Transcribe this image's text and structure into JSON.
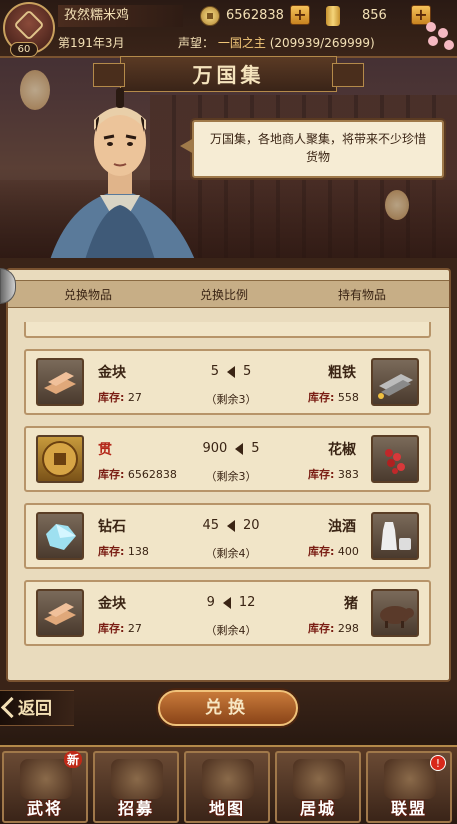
{
  "header": {
    "player_name": "孜然糯米鸡",
    "level": "60",
    "coins": "6562838",
    "gold": "856",
    "date": "第191年3月",
    "fame_label": "声望：",
    "fame_title": "一国之主",
    "fame_progress": "(209939/269999)"
  },
  "page": {
    "title": "万国集",
    "npc_dialog": "万国集，各地商人聚集，将带来不少珍惜货物"
  },
  "table": {
    "col_item": "兑换物品",
    "col_ratio": "兑换比例",
    "col_owned": "持有物品",
    "stock_label": "库存:",
    "rows": [
      {
        "give_name": "金块",
        "give_stock": "27",
        "give_icon": "gold-bar-icon",
        "ratio_give": "5",
        "ratio_get": "5",
        "remain": "（剩余3）",
        "get_name": "粗铁",
        "get_stock": "558",
        "get_icon": "iron-ingot-icon",
        "give_red": false
      },
      {
        "give_name": "贯",
        "give_stock": "6562838",
        "give_icon": "coin-icon",
        "ratio_give": "900",
        "ratio_get": "5",
        "remain": "（剩余3）",
        "get_name": "花椒",
        "get_stock": "383",
        "get_icon": "pepper-icon",
        "give_red": true
      },
      {
        "give_name": "钻石",
        "give_stock": "138",
        "give_icon": "diamond-icon",
        "ratio_give": "45",
        "ratio_get": "20",
        "remain": "（剩余4）",
        "get_name": "浊酒",
        "get_stock": "400",
        "get_icon": "sake-icon",
        "give_red": false
      },
      {
        "give_name": "金块",
        "give_stock": "27",
        "give_icon": "gold-bar-icon",
        "ratio_give": "9",
        "ratio_get": "12",
        "remain": "（剩余4）",
        "get_name": "猪",
        "get_stock": "298",
        "get_icon": "boar-icon",
        "give_red": false
      }
    ]
  },
  "controls": {
    "back_label": "返回",
    "exchange_label": "兑换"
  },
  "nav": {
    "generals": "武将",
    "recruit": "招募",
    "map": "地图",
    "castle": "居城",
    "alliance": "联盟",
    "new_badge": "新",
    "alert_badge": "!"
  },
  "colors": {
    "accent": "#b48a4a",
    "panel_bg": "#e9dbbd",
    "red_text": "#b4281a"
  }
}
